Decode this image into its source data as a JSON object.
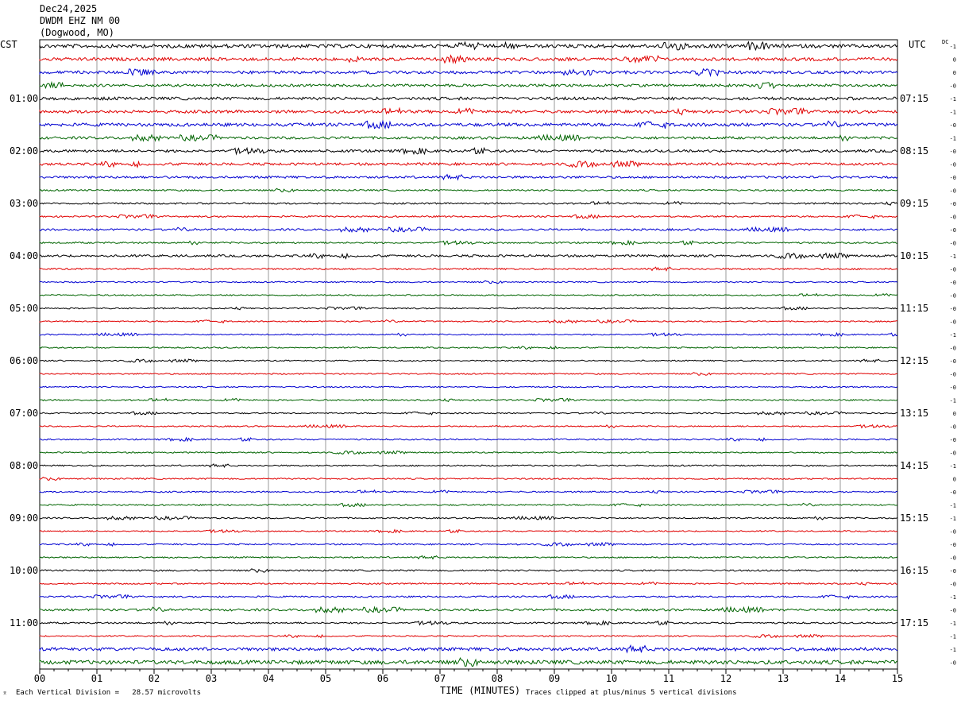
{
  "header": {
    "date": "Dec24,2025",
    "station": "DWDM EHZ NM 00",
    "location": "(Dogwood, MO)"
  },
  "left_tz": "CST",
  "right_tz": "UTC",
  "dc_label": "DC",
  "footer": {
    "scale_note": "Each Vertical Division =   28.57 microvolts",
    "clip_note": "Traces clipped at plus/minus 5 vertical divisions"
  },
  "colors": {
    "trace_cycle": [
      "#000000",
      "#e00000",
      "#0000d0",
      "#006400"
    ]
  },
  "chart_data": {
    "type": "line",
    "title": "Dec24,2025",
    "xlabel": "TIME (MINUTES)",
    "xlim": [
      0,
      15
    ],
    "x_ticks": [
      "00",
      "01",
      "02",
      "03",
      "04",
      "05",
      "06",
      "07",
      "08",
      "09",
      "10",
      "11",
      "12",
      "13",
      "14",
      "15"
    ],
    "traces_per_hour": 4,
    "trace_count": 48,
    "left_time_labels": [
      "01:00",
      "02:00",
      "03:00",
      "04:00",
      "05:00",
      "06:00",
      "07:00",
      "08:00",
      "09:00",
      "10:00",
      "11:00"
    ],
    "right_time_labels": [
      "07:15",
      "08:15",
      "09:15",
      "10:15",
      "11:15",
      "12:15",
      "13:15",
      "14:15",
      "15:15",
      "16:15",
      "17:15"
    ],
    "dc_offsets": [
      "-1",
      "0",
      "0",
      "-0",
      "-1",
      "-1",
      "-0",
      "-1",
      "-0",
      "-0",
      "-0",
      "-0",
      "-0",
      "-0",
      "-0",
      "-0",
      "-1",
      "-0",
      "-0",
      "-0",
      "-0",
      "-0",
      "-1",
      "-0",
      "-0",
      "-0",
      "-0",
      "-1",
      "0",
      "-0",
      "-0",
      "-0",
      "-1",
      "0",
      "-0",
      "-1",
      "-1",
      "-0",
      "-0",
      "-0",
      "-0",
      "-0",
      "-1",
      "-0",
      "-1",
      "-1",
      "-1",
      "-0"
    ],
    "noise_level": [
      0.55,
      0.5,
      0.45,
      0.4,
      0.45,
      0.45,
      0.5,
      0.4,
      0.4,
      0.4,
      0.35,
      0.25,
      0.25,
      0.25,
      0.3,
      0.25,
      0.35,
      0.25,
      0.2,
      0.2,
      0.2,
      0.2,
      0.2,
      0.2,
      0.2,
      0.2,
      0.2,
      0.22,
      0.2,
      0.2,
      0.22,
      0.2,
      0.22,
      0.22,
      0.22,
      0.22,
      0.22,
      0.2,
      0.22,
      0.22,
      0.25,
      0.22,
      0.25,
      0.35,
      0.25,
      0.2,
      0.5,
      0.6
    ]
  }
}
